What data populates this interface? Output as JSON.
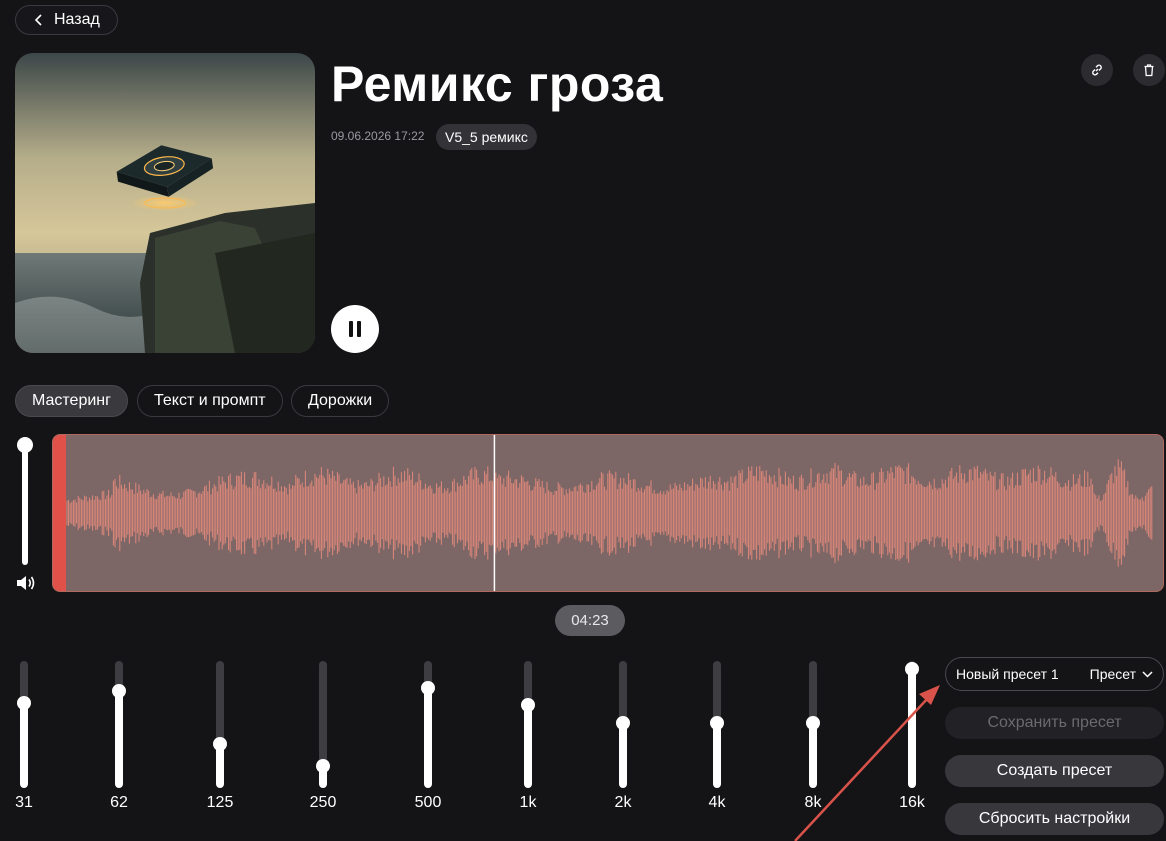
{
  "header": {
    "back_label": "Назад"
  },
  "track": {
    "title": "Ремикс гроза",
    "date": "09.06.2026 17:22",
    "version_badge": "V5_5 ремикс",
    "time": "04:23"
  },
  "tabs": [
    {
      "label": "Мастеринг",
      "active": true
    },
    {
      "label": "Текст и промпт",
      "active": false
    },
    {
      "label": "Дорожки",
      "active": false
    }
  ],
  "volume": {
    "level": 1.0
  },
  "playback": {
    "state": "playing",
    "position": 0.397
  },
  "equalizer": {
    "bands": [
      {
        "label": "31",
        "level": 0.67
      },
      {
        "label": "62",
        "level": 0.76
      },
      {
        "label": "125",
        "level": 0.35
      },
      {
        "label": "250",
        "level": 0.17
      },
      {
        "label": "500",
        "level": 0.79
      },
      {
        "label": "1k",
        "level": 0.65
      },
      {
        "label": "2k",
        "level": 0.51
      },
      {
        "label": "4k",
        "level": 0.51
      },
      {
        "label": "8k",
        "level": 0.51
      },
      {
        "label": "16k",
        "level": 0.94
      }
    ]
  },
  "presets": {
    "current_name": "Новый пресет 1",
    "dropdown_label": "Пресет",
    "save_label": "Сохранить пресет",
    "create_label": "Создать пресет",
    "reset_label": "Сбросить настройки"
  },
  "colors": {
    "background": "#141316",
    "waveform": "#e0897a",
    "waveform_bg": "#7c6666",
    "played_marker": "#e0514a",
    "annotation_arrow": "#d9534a"
  }
}
